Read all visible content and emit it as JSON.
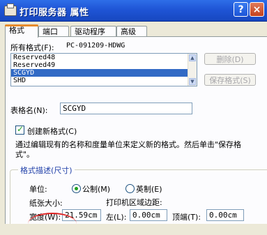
{
  "window": {
    "title": "打印服务器 属性",
    "help_glyph": "?",
    "close_glyph": "×"
  },
  "tabs": [
    {
      "label": "格式"
    },
    {
      "label": "端口"
    },
    {
      "label": "驱动程序"
    },
    {
      "label": "高级"
    }
  ],
  "formats": {
    "label": "所有格式(F):",
    "server_name": "PC-091209-HDWG",
    "items": [
      "Reserved48",
      "Reserved49",
      "SCGYD",
      "SHD"
    ],
    "selected_index": 2
  },
  "buttons": {
    "delete": "删除(D)",
    "save": "保存格式(S)"
  },
  "form_name": {
    "label": "表格名(N):",
    "value": "SCGYD"
  },
  "create_new": {
    "label": "创建新格式(C)",
    "checked": true
  },
  "hint_text": "通过编辑现有的名称和度量单位来定义新的格式。然后单击\"保存格式\"。",
  "format_desc": {
    "title": "格式描述(尺寸)",
    "unit_label": "单位:",
    "unit_metric": "公制(M)",
    "unit_imperial": "英制(E)",
    "selected_unit": "metric",
    "paper_size_label": "纸张大小:",
    "printable_area_label": "打印机区域边距:",
    "width_label": "宽度(W):",
    "width_value": "21.59cm",
    "left_label": "左(L):",
    "left_value": "0.00cm",
    "top_label": "顶端(T):",
    "top_value": "0.00cm"
  },
  "colors": {
    "titlebar": "#1f55d6",
    "tab_highlight": "#e68b2c",
    "selection": "#316ac5",
    "annotation": "#dd2222"
  }
}
